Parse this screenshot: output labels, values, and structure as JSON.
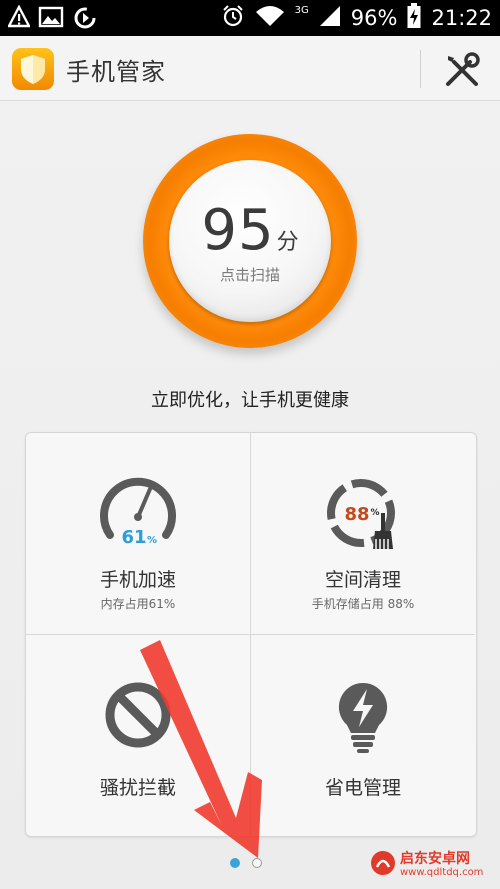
{
  "status_bar": {
    "left_icons": [
      "warning-icon",
      "image-icon",
      "sync-icon"
    ],
    "right_icons": [
      "alarm-icon",
      "wifi-icon",
      "signal-icon",
      "battery-charging-icon"
    ],
    "network": "3G",
    "battery": "96%",
    "time": "21:22"
  },
  "header": {
    "title": "手机管家",
    "logo_icon": "shield-logo-icon",
    "tools_icon": "tools-icon"
  },
  "score": {
    "value": "95",
    "unit": "分",
    "action": "点击扫描",
    "ring_color": "#f7850a"
  },
  "slogan": "立即优化，让手机更健康",
  "features": [
    {
      "title": "手机加速",
      "subtitle": "内存占用61%",
      "value": "61",
      "unit": "%",
      "icon": "speedometer-icon",
      "value_color": "#2a9fd6"
    },
    {
      "title": "空间清理",
      "subtitle": "手机存储占用 88%",
      "value": "88",
      "unit": "%",
      "icon": "broom-icon",
      "value_color": "#c44a1c"
    },
    {
      "title": "骚扰拦截",
      "subtitle": "",
      "icon": "block-icon"
    },
    {
      "title": "省电管理",
      "subtitle": "",
      "icon": "bulb-bolt-icon"
    }
  ],
  "pager": {
    "pages": 2,
    "active": 1,
    "active_color": "#3aa3d8"
  },
  "watermark": {
    "title": "启东安卓网",
    "url": "www.qdltdq.com"
  }
}
